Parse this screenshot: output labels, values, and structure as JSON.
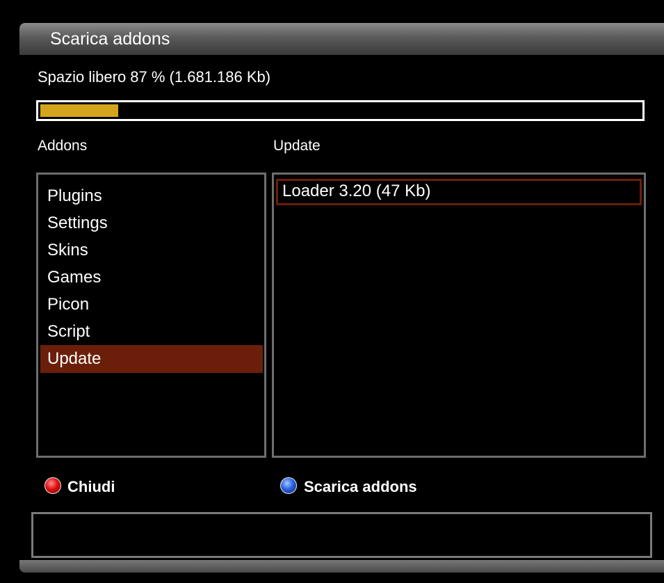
{
  "window": {
    "title": "Scarica addons"
  },
  "storage": {
    "free_text": "Spazio libero 87 % (1.681.186 Kb)",
    "used_fraction": 0.13
  },
  "columns": {
    "left_header": "Addons",
    "right_header": "Update"
  },
  "addons": {
    "items": [
      "Plugins",
      "Settings",
      "Skins",
      "Games",
      "Picon",
      "Script",
      "Update"
    ],
    "selected_index": 6
  },
  "updates": {
    "items": [
      "Loader  3.20 (47 Kb)"
    ]
  },
  "buttons": {
    "red": {
      "label": "Chiudi",
      "icon": "red-key-icon",
      "color": "#e01010"
    },
    "blue": {
      "label": "Scarica addons",
      "icon": "blue-key-icon",
      "color": "#2a62e0"
    }
  },
  "info": {
    "text": ""
  },
  "colors": {
    "progress": "#d4a51c",
    "selection": "#6b1f0a",
    "border": "#6e6e6e"
  }
}
